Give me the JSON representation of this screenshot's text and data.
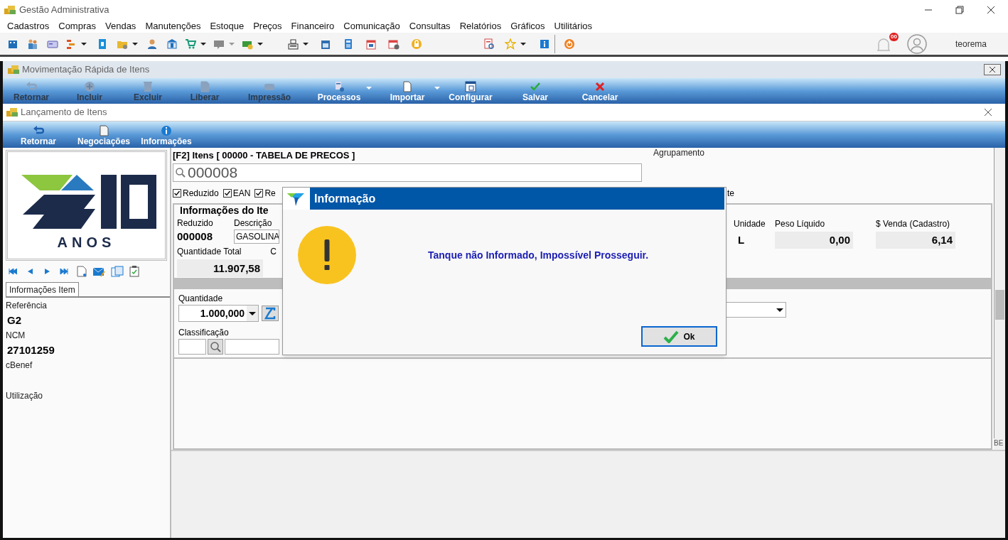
{
  "app_window": {
    "title": "Gestão Administrativa"
  },
  "menu": [
    "Cadastros",
    "Compras",
    "Vendas",
    "Manutenções",
    "Estoque",
    "Preços",
    "Financeiro",
    "Comunicação",
    "Consultas",
    "Relatórios",
    "Gráficos",
    "Utilitários"
  ],
  "notifications": {
    "badge": "00"
  },
  "user": {
    "name": "teorema"
  },
  "child_window": {
    "title": "Movimentação Rápida de Itens",
    "toolbar": [
      {
        "label": "Retornar",
        "kind": "back",
        "disabled": true,
        "dropdown": false
      },
      {
        "label": "Incluir",
        "kind": "add",
        "disabled": true,
        "dropdown": false
      },
      {
        "label": "Excluir",
        "kind": "trash",
        "disabled": true,
        "dropdown": false
      },
      {
        "label": "Liberar",
        "kind": "page",
        "disabled": true,
        "dropdown": false
      },
      {
        "label": "Impressão",
        "kind": "printer",
        "disabled": true,
        "dropdown": false
      },
      {
        "label": "Processos",
        "kind": "process",
        "disabled": false,
        "dropdown": true
      },
      {
        "label": "Importar",
        "kind": "import",
        "disabled": false,
        "dropdown": true
      },
      {
        "label": "Configurar",
        "kind": "config",
        "disabled": false,
        "dropdown": false
      },
      {
        "label": "Salvar",
        "kind": "check",
        "disabled": false,
        "dropdown": false
      },
      {
        "label": "Cancelar",
        "kind": "cross",
        "disabled": false,
        "dropdown": false
      }
    ]
  },
  "form_window": {
    "title": "Lançamento de Itens",
    "toolbar": [
      {
        "label": "Retornar",
        "kind": "back"
      },
      {
        "label": "Negociações",
        "kind": "page"
      },
      {
        "label": "Informações",
        "kind": "info"
      }
    ]
  },
  "left_panel": {
    "logo_text": "ANOS",
    "tabs": [
      {
        "label": "Informações Item",
        "selected": true
      }
    ],
    "fields": [
      {
        "label": "Referência",
        "value": "G2"
      },
      {
        "label": "NCM",
        "value": "27101259"
      },
      {
        "label": "cBenef"
      },
      {
        "label": "Utilização"
      }
    ]
  },
  "item_search": {
    "title": "[F2] Itens [ 00000 - TABELA DE PRECOS ]",
    "value": "000008",
    "grouping_label": "Agrupamento"
  },
  "filters": [
    {
      "label": "Reduzido",
      "checked": true
    },
    {
      "label": "EAN",
      "checked": true
    },
    {
      "label": "Re",
      "checked": true
    }
  ],
  "filter_tail": "te",
  "item_info": {
    "title": "Informações do Ite",
    "reduzido_label": "Reduzido",
    "reduzido": "000008",
    "descricao_label": "Descrição",
    "descricao": "GASOLINA",
    "total_label": "Quantidade Total",
    "total": "11.907,58",
    "column_3_label": "C",
    "unit_label": "Unidade",
    "unit": "L",
    "weight_label": "Peso Líquido",
    "weight": "0,00",
    "price_label": "$ Venda (Cadastro)",
    "price": "6,14"
  },
  "quantity": {
    "label": "Quantidade",
    "value": "1.000,000"
  },
  "classification": {
    "label": "Classificação"
  },
  "dialog": {
    "title": "Informação",
    "message": "Tanque não Informado, Impossível Prosseguir.",
    "button": "Ok"
  },
  "corner_text": "BE"
}
